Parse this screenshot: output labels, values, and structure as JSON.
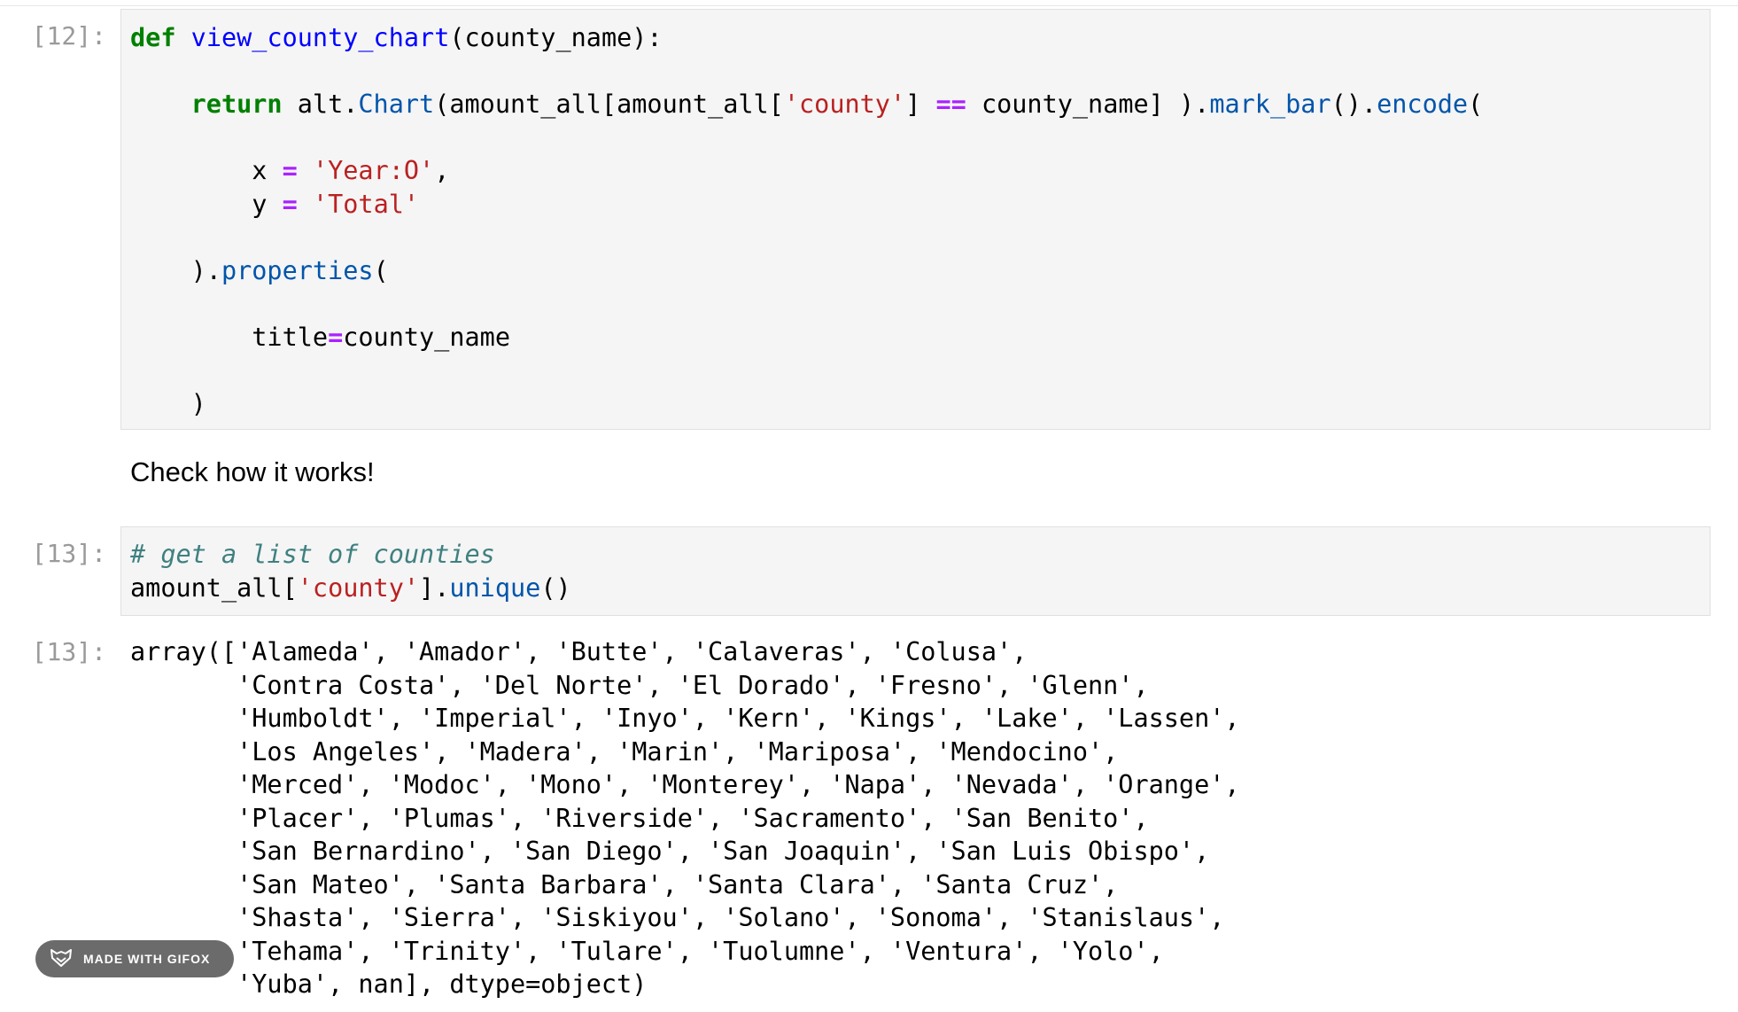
{
  "cells": [
    {
      "prompt": "[12]:",
      "code_lines": [
        [
          {
            "t": "def",
            "c": "kw"
          },
          {
            "t": " "
          },
          {
            "t": "view_county_chart",
            "c": "fn"
          },
          {
            "t": "(county_name):"
          }
        ],
        [],
        [
          {
            "t": "    "
          },
          {
            "t": "return",
            "c": "kw"
          },
          {
            "t": " alt."
          },
          {
            "t": "Chart",
            "c": "attr"
          },
          {
            "t": "(amount_all[amount_all["
          },
          {
            "t": "'county'",
            "c": "str"
          },
          {
            "t": "] "
          },
          {
            "t": "==",
            "c": "op"
          },
          {
            "t": " county_name] )."
          },
          {
            "t": "mark_bar",
            "c": "attr"
          },
          {
            "t": "()."
          },
          {
            "t": "encode",
            "c": "attr"
          },
          {
            "t": "("
          }
        ],
        [],
        [
          {
            "t": "        x "
          },
          {
            "t": "=",
            "c": "op"
          },
          {
            "t": " "
          },
          {
            "t": "'Year:O'",
            "c": "str"
          },
          {
            "t": ","
          }
        ],
        [
          {
            "t": "        y "
          },
          {
            "t": "=",
            "c": "op"
          },
          {
            "t": " "
          },
          {
            "t": "'Total'",
            "c": "str"
          }
        ],
        [],
        [
          {
            "t": "    )."
          },
          {
            "t": "properties",
            "c": "attr"
          },
          {
            "t": "("
          }
        ],
        [],
        [
          {
            "t": "        title"
          },
          {
            "t": "=",
            "c": "op"
          },
          {
            "t": "county_name"
          }
        ],
        [],
        [
          {
            "t": "    )"
          }
        ]
      ]
    },
    {
      "markdown": "Check how it works!"
    },
    {
      "prompt": "[13]:",
      "code_lines": [
        [
          {
            "t": "# get a list of counties",
            "c": "cm"
          }
        ],
        [
          {
            "t": "amount_all["
          },
          {
            "t": "'county'",
            "c": "str"
          },
          {
            "t": "]."
          },
          {
            "t": "unique",
            "c": "attr"
          },
          {
            "t": "()"
          }
        ]
      ]
    },
    {
      "output_prompt": "[13]:",
      "output_lines": [
        "array(['Alameda', 'Amador', 'Butte', 'Calaveras', 'Colusa',",
        "       'Contra Costa', 'Del Norte', 'El Dorado', 'Fresno', 'Glenn',",
        "       'Humboldt', 'Imperial', 'Inyo', 'Kern', 'Kings', 'Lake', 'Lassen',",
        "       'Los Angeles', 'Madera', 'Marin', 'Mariposa', 'Mendocino',",
        "       'Merced', 'Modoc', 'Mono', 'Monterey', 'Napa', 'Nevada', 'Orange',",
        "       'Placer', 'Plumas', 'Riverside', 'Sacramento', 'San Benito',",
        "       'San Bernardino', 'San Diego', 'San Joaquin', 'San Luis Obispo',",
        "       'San Mateo', 'Santa Barbara', 'Santa Clara', 'Santa Cruz',",
        "       'Shasta', 'Sierra', 'Siskiyou', 'Solano', 'Sonoma', 'Stanislaus',",
        "       'Tehama', 'Trinity', 'Tulare', 'Tuolumne', 'Ventura', 'Yolo',",
        "       'Yuba', nan], dtype=object)"
      ]
    }
  ],
  "badge": {
    "label": "MADE WITH GIFOX",
    "icon": "fox-icon"
  },
  "colors": {
    "keyword": "#008000",
    "function": "#0000ff",
    "attribute": "#0055aa",
    "string": "#ba2121",
    "operator": "#aa22ff",
    "comment": "#408080",
    "prompt": "#9a9a9a",
    "input_bg": "#f5f5f5"
  }
}
